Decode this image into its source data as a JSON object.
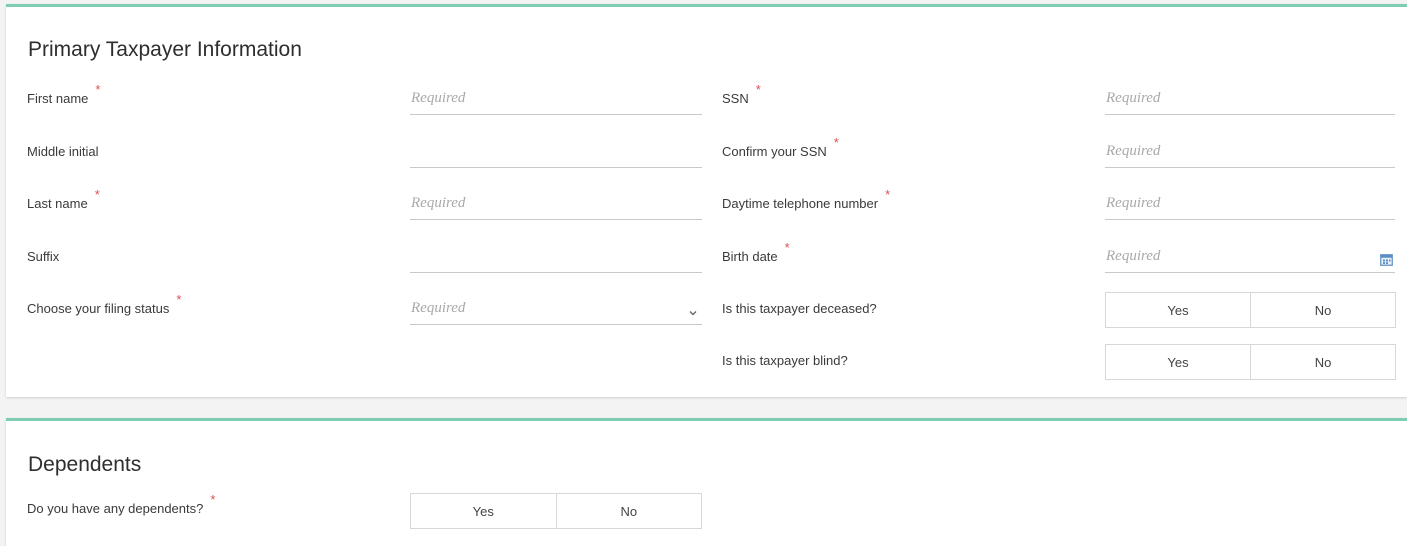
{
  "primary": {
    "title": "Primary Taxpayer Information",
    "required_mark": "*",
    "fields": {
      "first_name": {
        "label": "First name",
        "placeholder": "Required"
      },
      "middle_initial": {
        "label": "Middle initial"
      },
      "last_name": {
        "label": "Last name",
        "placeholder": "Required"
      },
      "suffix": {
        "label": "Suffix"
      },
      "filing_status": {
        "label": "Choose your filing status",
        "placeholder": "Required"
      },
      "ssn": {
        "label": "SSN",
        "placeholder": "Required"
      },
      "confirm_ssn": {
        "label": "Confirm your SSN",
        "placeholder": "Required"
      },
      "phone": {
        "label": "Daytime telephone number",
        "placeholder": "Required"
      },
      "birth_date": {
        "label": "Birth date",
        "placeholder": "Required"
      },
      "deceased": {
        "label": "Is this taxpayer deceased?",
        "yes": "Yes",
        "no": "No"
      },
      "blind": {
        "label": "Is this taxpayer blind?",
        "yes": "Yes",
        "no": "No"
      }
    }
  },
  "dependents": {
    "title": "Dependents",
    "question": {
      "label": "Do you have any dependents?",
      "yes": "Yes",
      "no": "No"
    }
  },
  "colors": {
    "accent_border": "#7fcdb0",
    "required_mark": "#d9534f",
    "calendar_icon": "#5b8ec4"
  },
  "icons": {
    "select_chevron": "chevron-down-icon",
    "date_picker": "calendar-icon"
  }
}
